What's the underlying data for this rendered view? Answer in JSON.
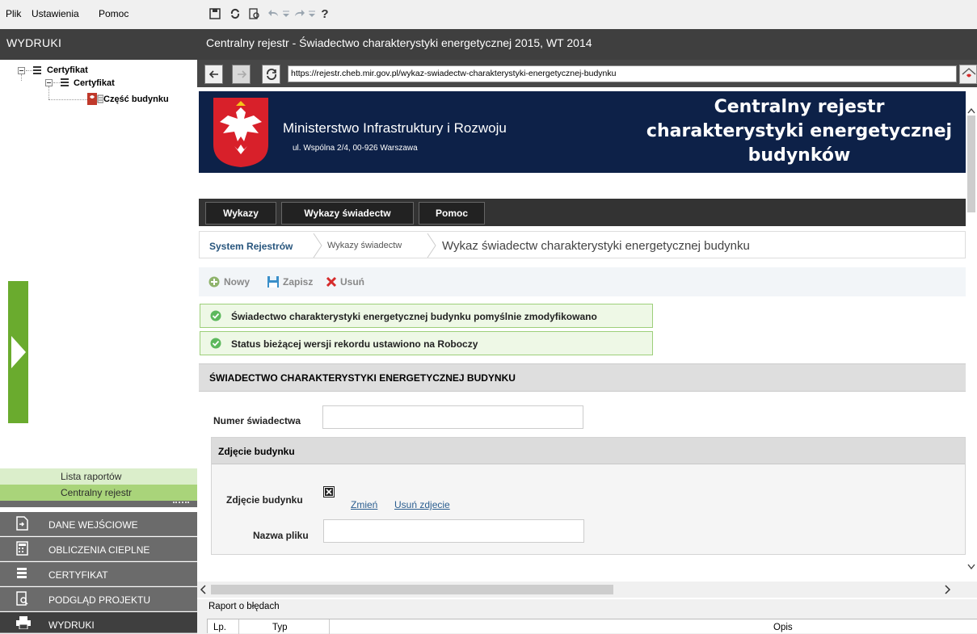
{
  "menu": {
    "items": [
      {
        "label": "Plik"
      },
      {
        "label": "Ustawienia"
      },
      {
        "label": "Pomoc"
      }
    ]
  },
  "left": {
    "header": "WYDRUKI",
    "tree": [
      {
        "label": "Certyfikat",
        "level": 0
      },
      {
        "label": "Certyfikat",
        "level": 1
      },
      {
        "label": "Część budynku",
        "level": 2
      }
    ],
    "links": [
      "Lista raportów",
      "Centralny rejestr"
    ],
    "nav": [
      {
        "label": "DANE WEJŚCIOWE",
        "icon": "document-arrow-icon"
      },
      {
        "label": "OBLICZENIA CIEPLNE",
        "icon": "calculator-icon"
      },
      {
        "label": "CERTYFIKAT",
        "icon": "stack-icon"
      },
      {
        "label": "PODGLĄD PROJEKTU",
        "icon": "preview-icon"
      },
      {
        "label": "WYDRUKI",
        "icon": "printer-icon"
      }
    ]
  },
  "right": {
    "header": "Centralny rejestr - Świadectwo charakterystyki energetycznej 2015, WT 2014"
  },
  "browser": {
    "url": "https://rejestr.cheb.mir.gov.pl/wykaz-swiadectw-charakterystyki-energetycznej-budynku"
  },
  "site": {
    "ministry": "Ministerstwo Infrastruktury i Rozwoju",
    "address": "ul. Wspólna 2/4, 00-926 Warszawa",
    "title_lines": [
      "Centralny rejestr",
      "charakterystyki energetycznej",
      "budynków"
    ],
    "nav": [
      "Wykazy",
      "Wykazy świadectw",
      "Pomoc"
    ],
    "breadcrumb": [
      "System Rejestrów",
      "Wykazy świadectw",
      "Wykaz świadectw charakterystyki energetycznej budynku"
    ],
    "toolbar": {
      "new": "Nowy",
      "save": "Zapisz",
      "delete": "Usuń"
    },
    "messages": [
      "Świadectwo charakterystyki energetycznej budynku pomyślnie zmodyfikowano",
      "Status bieżącej wersji rekordu ustawiono na Roboczy"
    ],
    "section_title": "ŚWIADECTWO CHARAKTERYSTYKI ENERGETYCZNEJ BUDYNKU",
    "form": {
      "number_label": "Numer świadectwa",
      "number_value": "",
      "photo_section": "Zdjęcie budynku",
      "photo_label": "Zdjęcie budynku",
      "change_link": "Zmień",
      "remove_link": "Usuń zdjecie",
      "filename_label": "Nazwa pliku",
      "filename_value": ""
    }
  },
  "report": {
    "title": "Raport o błędach",
    "columns": [
      "Lp.",
      "Typ",
      "Opis"
    ]
  },
  "colors": {
    "dark_header": "#3f3f3f",
    "banner": "#0d2148",
    "green": "#6aab2e",
    "nav_gray": "#6b6b6b"
  }
}
